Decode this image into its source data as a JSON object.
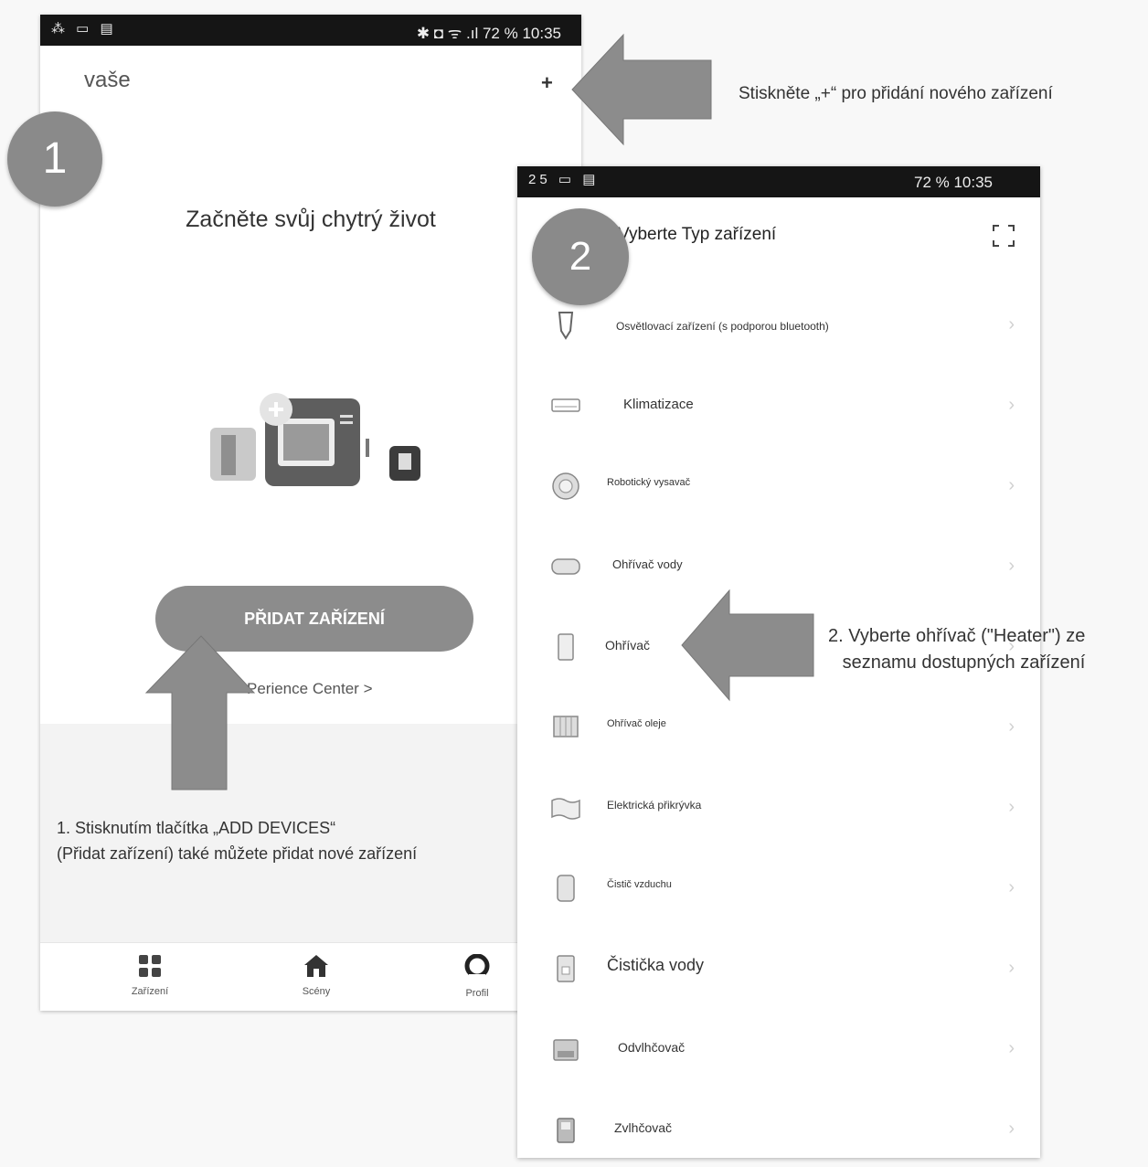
{
  "screen1": {
    "status_left": "⁂ ▭ ▤",
    "status_right": "✱ ◘ ᯤ .ıl 72 % 10:35",
    "title": "vaše",
    "plus": "+",
    "headline": "Začněte svůj chytrý život",
    "add_button": "PŘIDAT ZAŘÍZENÍ",
    "experience_link": "Perience Center >",
    "nav": [
      {
        "label": "Zařízení",
        "icon": "grid-icon"
      },
      {
        "label": "Scény",
        "icon": "home-icon"
      },
      {
        "label": "Profil",
        "icon": "profile-icon"
      }
    ]
  },
  "screen2": {
    "status_left": "25 ▭ ▤",
    "status_right": "72 % 10:35",
    "title": "Vyberte Typ zařízení",
    "items": [
      {
        "label": "Osvětlovací zařízení (s podporou bluetooth)",
        "icon": "bulb-icon"
      },
      {
        "label": "Klimatizace",
        "icon": "air-conditioner-icon"
      },
      {
        "label": "Robotický vysavač",
        "icon": "robot-vacuum-icon"
      },
      {
        "label": "Ohřívač vody",
        "icon": "water-heater-icon"
      },
      {
        "label": "Ohřívač",
        "icon": "heater-icon"
      },
      {
        "label": "Ohřívač oleje",
        "icon": "oil-heater-icon"
      },
      {
        "label": "Elektrická přikrývka",
        "icon": "electric-blanket-icon"
      },
      {
        "label": "Čistič vzduchu",
        "icon": "air-purifier-icon"
      },
      {
        "label": "Čistička vody",
        "icon": "water-purifier-icon"
      },
      {
        "label": "Odvlhčovač",
        "icon": "dehumidifier-icon"
      },
      {
        "label": "Zvlhčovač",
        "icon": "humidifier-icon"
      }
    ],
    "chevron": "›"
  },
  "step1": "1",
  "step2": "2",
  "annotations": {
    "plus_hint": "Stiskněte „+“ pro přidání nového zařízení",
    "heater_hint_1": "2. Vyberte ohřívač (\"Heater\") ze",
    "heater_hint_2": "seznamu dostupných zařízení",
    "add_hint_1": "1. Stisknutím tlačítka „ADD DEVICES“",
    "add_hint_2": "(Přidat zařízení) také můžete přidat nové zařízení"
  },
  "colors": {
    "arrow": "#8c8c8c",
    "circle": "#8a8a8a",
    "status_bar": "#151515"
  }
}
